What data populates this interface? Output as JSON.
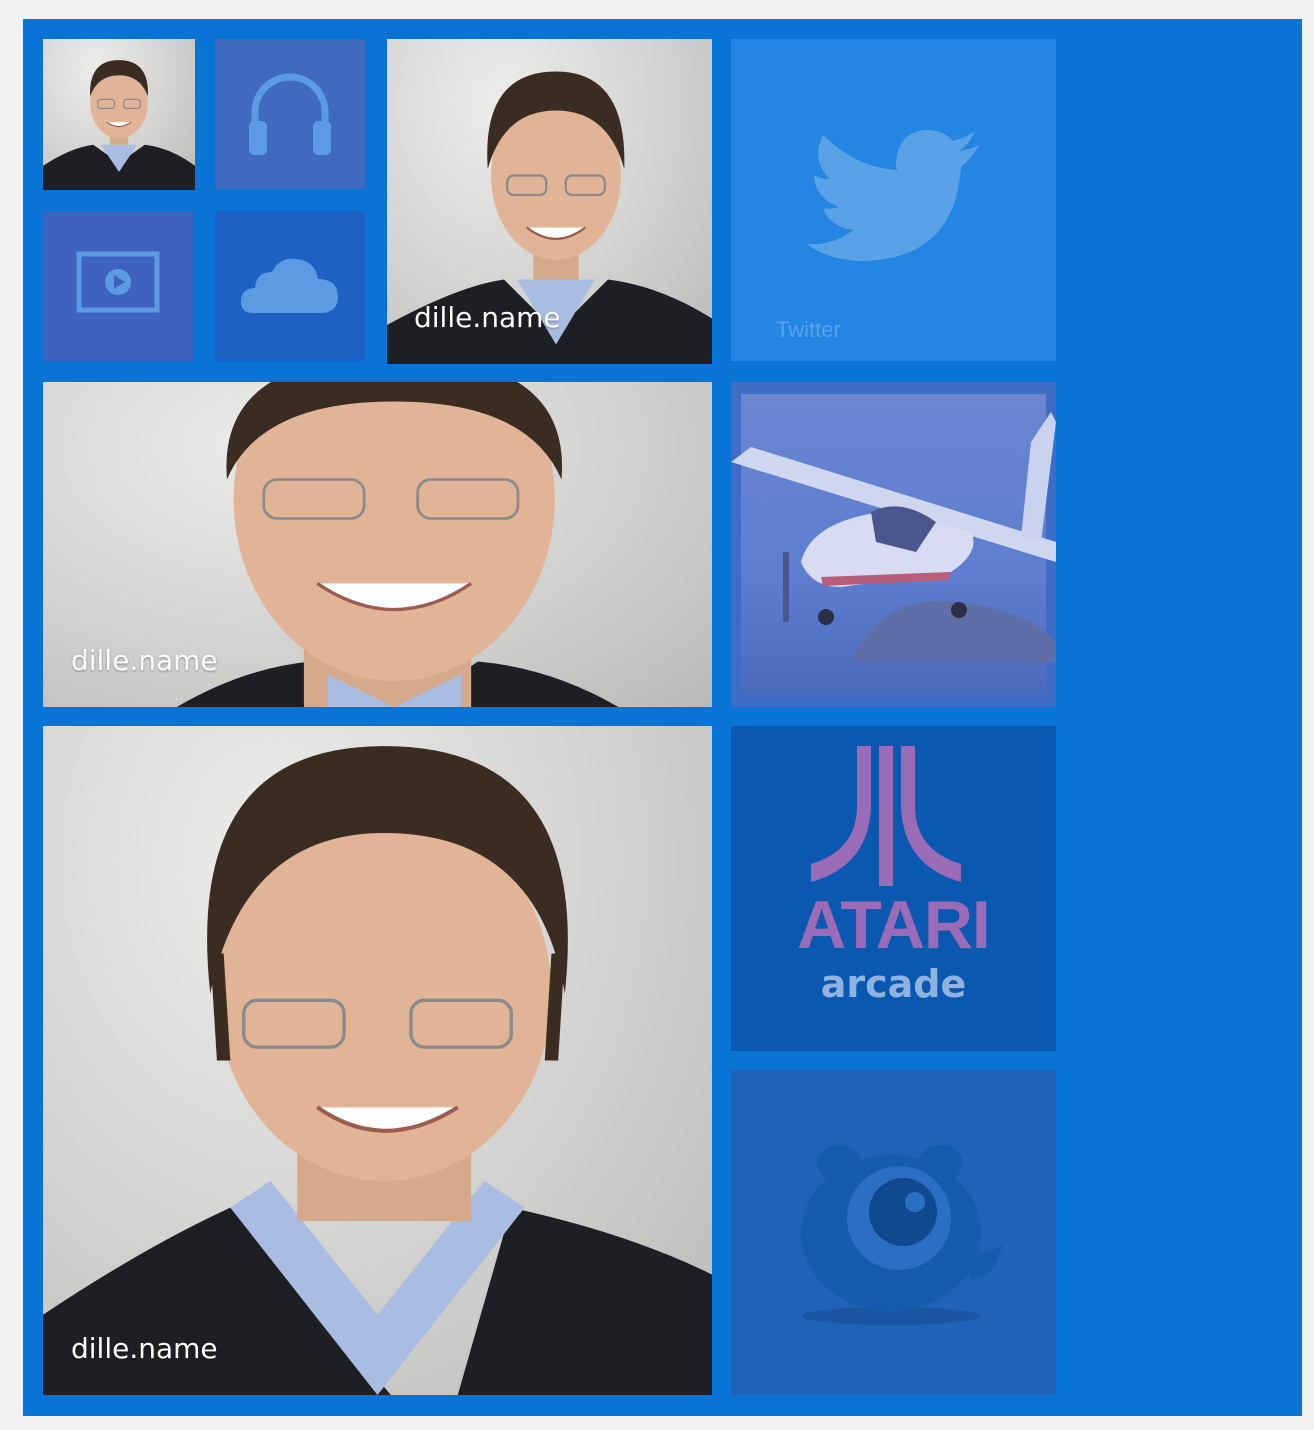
{
  "start_screen": {
    "background_color": "#0a74d6",
    "tiles": [
      {
        "id": "profile-photo-small",
        "kind": "photo",
        "label": ""
      },
      {
        "id": "music",
        "kind": "app",
        "icon": "headphones-icon",
        "color": "#3f6ac0"
      },
      {
        "id": "profile-photo-medium",
        "kind": "photo",
        "label": "dille.name"
      },
      {
        "id": "twitter",
        "kind": "app",
        "icon": "twitter-bird-icon",
        "label": "Twitter",
        "color": "#2485e2"
      },
      {
        "id": "video",
        "kind": "app",
        "icon": "video-player-icon",
        "color": "#3f61c0"
      },
      {
        "id": "onedrive",
        "kind": "app",
        "icon": "cloud-icon",
        "color": "#1d62c2"
      },
      {
        "id": "profile-photo-wide",
        "kind": "photo",
        "label": "dille.name"
      },
      {
        "id": "flight-game",
        "kind": "app",
        "icon": "airplane-icon",
        "color": "#3f6cc4"
      },
      {
        "id": "profile-photo-large",
        "kind": "photo",
        "label": "dille.name"
      },
      {
        "id": "atari-arcade",
        "kind": "app",
        "icon": "atari-logo-icon",
        "brand": "ATARI",
        "sub": "arcade",
        "color": "#0a58b0"
      },
      {
        "id": "game-creature",
        "kind": "app",
        "icon": "creature-icon",
        "color": "#1f62b8"
      }
    ]
  }
}
